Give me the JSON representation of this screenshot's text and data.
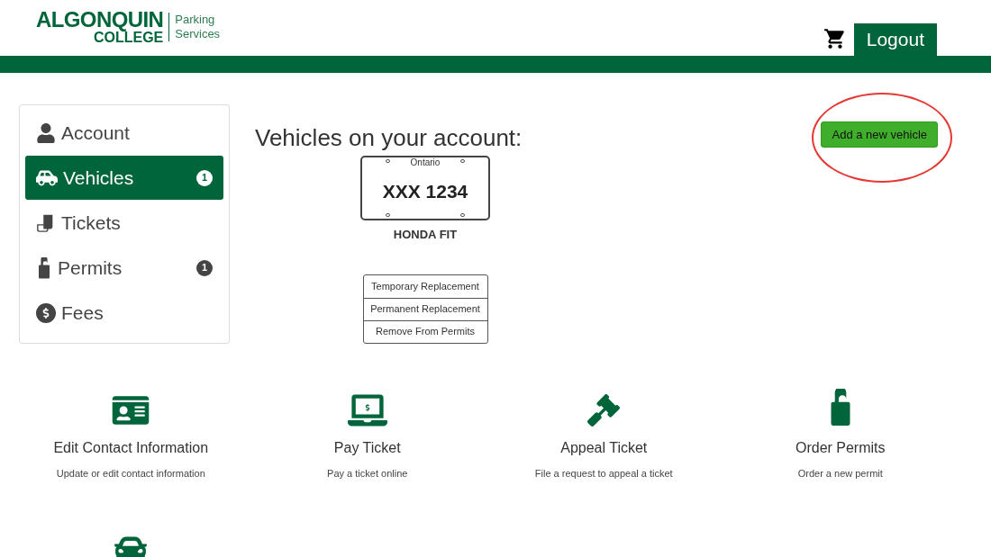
{
  "header": {
    "logo": {
      "line_1": "ALGONQUIN",
      "line_2": "COLLEGE",
      "tag_1": "Parking",
      "tag_2": "Services"
    },
    "logout": "Logout"
  },
  "sidebar": {
    "items": [
      {
        "label": "Account",
        "selected": false
      },
      {
        "label": "Vehicles",
        "selected": true,
        "badge": "1"
      },
      {
        "label": "Tickets",
        "selected": false
      },
      {
        "label": "Permits",
        "selected": false,
        "badge": "1"
      },
      {
        "label": "Fees",
        "selected": false
      }
    ]
  },
  "main": {
    "heading": "Vehicles on your account:",
    "add_button": "Add a new vehicle",
    "vehicles": [
      {
        "province": "Ontario",
        "plate": "XXX 1234",
        "model": "HONDA FIT",
        "actions": [
          "Temporary Replacement",
          "Permanent Replacement",
          "Remove From Permits"
        ]
      }
    ]
  },
  "tiles": [
    {
      "title": "Edit Contact Information",
      "description": "Update or edit contact information"
    },
    {
      "title": "Pay Ticket",
      "description": "Pay a ticket online"
    },
    {
      "title": "Appeal Ticket",
      "description": "File a request to appeal a ticket"
    },
    {
      "title": "Order Permits",
      "description": "Order a new permit"
    }
  ]
}
